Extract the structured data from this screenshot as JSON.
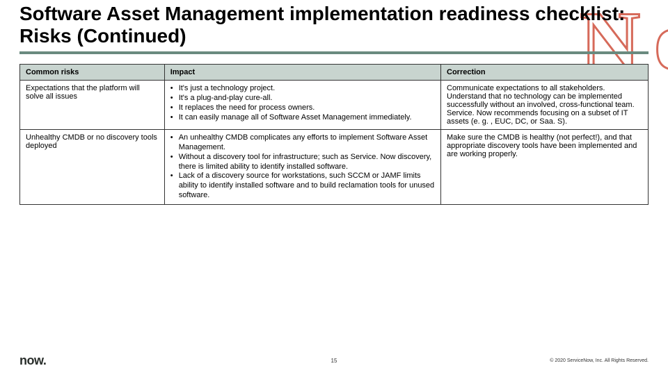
{
  "title": "Software Asset Management implementation readiness checklist: Risks (Continued)",
  "watermark": "No",
  "table": {
    "headers": {
      "risk": "Common risks",
      "impact": "Impact",
      "correction": "Correction"
    },
    "rows": [
      {
        "risk": "Expectations that the platform will solve all issues",
        "impact": [
          "It's just a technology project.",
          "It's a plug-and-play cure-all.",
          "It replaces the need for process owners.",
          "It can easily manage all of Software Asset Management immediately."
        ],
        "correction": "Communicate expectations to all stakeholders. Understand that no technology can be implemented successfully without an involved, cross-functional team. Service. Now recommends focusing on a subset of IT assets (e. g. , EUC, DC, or Saa. S)."
      },
      {
        "risk": "Unhealthy CMDB or no discovery tools deployed",
        "impact": [
          "An unhealthy CMDB complicates any efforts to implement Software Asset Management.",
          "Without a discovery tool for infrastructure; such as Service. Now discovery, there is limited ability to identify installed software.",
          "Lack of a discovery source for workstations, such SCCM or JAMF limits ability to identify installed software and to build reclamation tools for unused software."
        ],
        "correction": "Make sure the CMDB is healthy (not perfect!), and that appropriate discovery tools have been implemented and are working properly."
      }
    ]
  },
  "footer": {
    "logo": "now.",
    "page": "15",
    "copyright": "© 2020 ServiceNow, Inc. All Rights Reserved."
  }
}
